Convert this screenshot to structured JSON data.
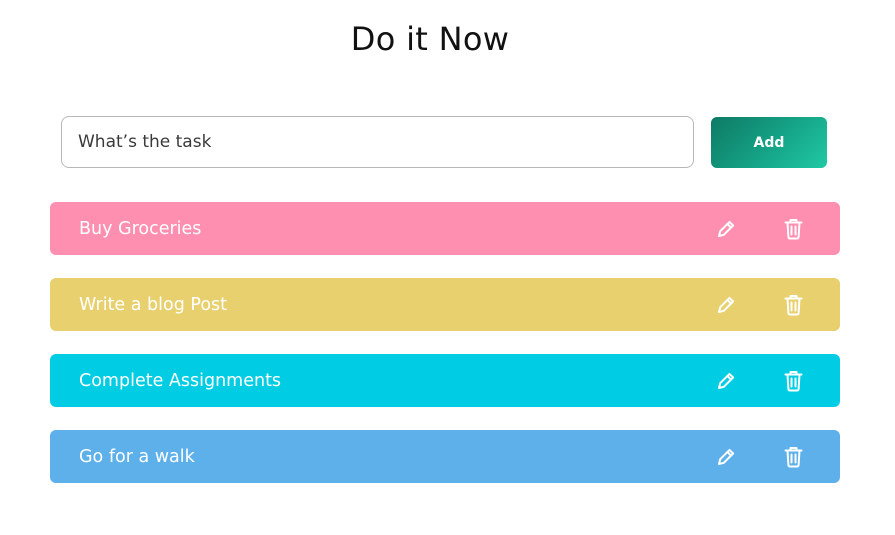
{
  "app": {
    "title": "Do it Now"
  },
  "form": {
    "input_placeholder": "What’s the task",
    "input_value": "",
    "add_label": "Add"
  },
  "tasks": [
    {
      "label": "Buy Groceries",
      "color": "#ff8fb0",
      "edit_icon": "pencil-icon",
      "delete_icon": "trash-icon"
    },
    {
      "label": "Write a blog Post",
      "color": "#e8d06e",
      "edit_icon": "pencil-icon",
      "delete_icon": "trash-icon"
    },
    {
      "label": "Complete Assignments",
      "color": "#00cde4",
      "edit_icon": "pencil-icon",
      "delete_icon": "trash-icon"
    },
    {
      "label": "Go for a walk",
      "color": "#5db0ea",
      "edit_icon": "pencil-icon",
      "delete_icon": "trash-icon"
    }
  ],
  "colors": {
    "add_button_start": "#0e7a64",
    "add_button_end": "#20c9a4",
    "text_on_task": "#ffffff"
  }
}
